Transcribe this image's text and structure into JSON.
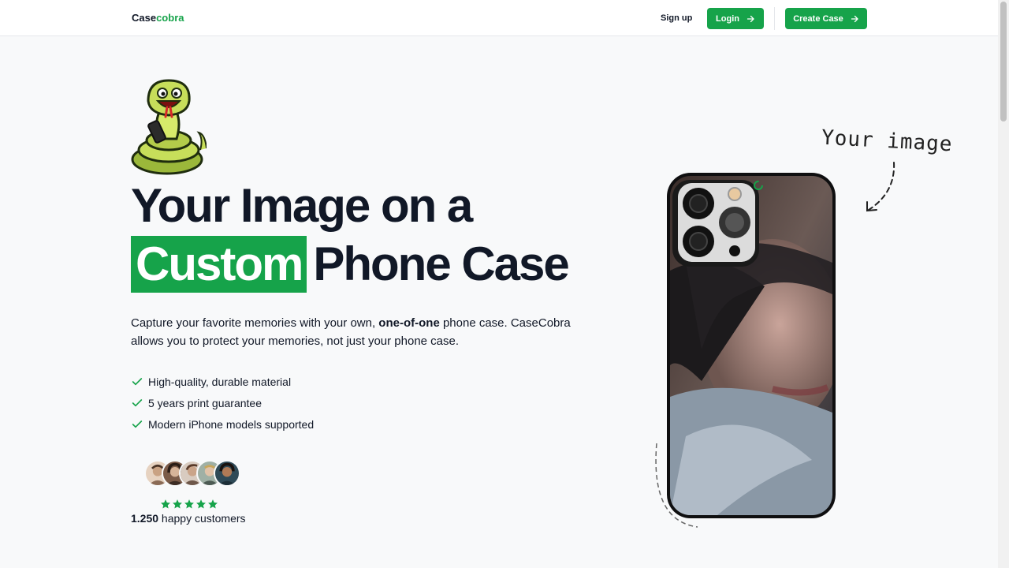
{
  "nav": {
    "brand_part1": "Case",
    "brand_part2": "cobra",
    "signup_label": "Sign up",
    "login_label": "Login",
    "create_label": "Create Case"
  },
  "hero": {
    "title_line1": "Your Image on a",
    "title_highlight": "Custom",
    "title_line2_rest": "Phone Case",
    "desc_part1": "Capture your favorite memories with your own, ",
    "desc_bold": "one-of-one",
    "desc_part2": " phone case. CaseCobra allows you to protect your memories, not just your phone case.",
    "features": [
      "High-quality, durable material",
      "5 years print guarantee",
      "Modern iPhone models supported"
    ],
    "rating_stars": 5,
    "customers_count": "1.250",
    "customers_label": " happy customers"
  },
  "showcase": {
    "annotation": "Your image"
  },
  "colors": {
    "accent": "#16a34a",
    "text": "#111827",
    "background": "#f8f9fa"
  },
  "icons": {
    "arrow": "arrow-right-icon",
    "check": "check-icon",
    "star": "star-icon"
  }
}
